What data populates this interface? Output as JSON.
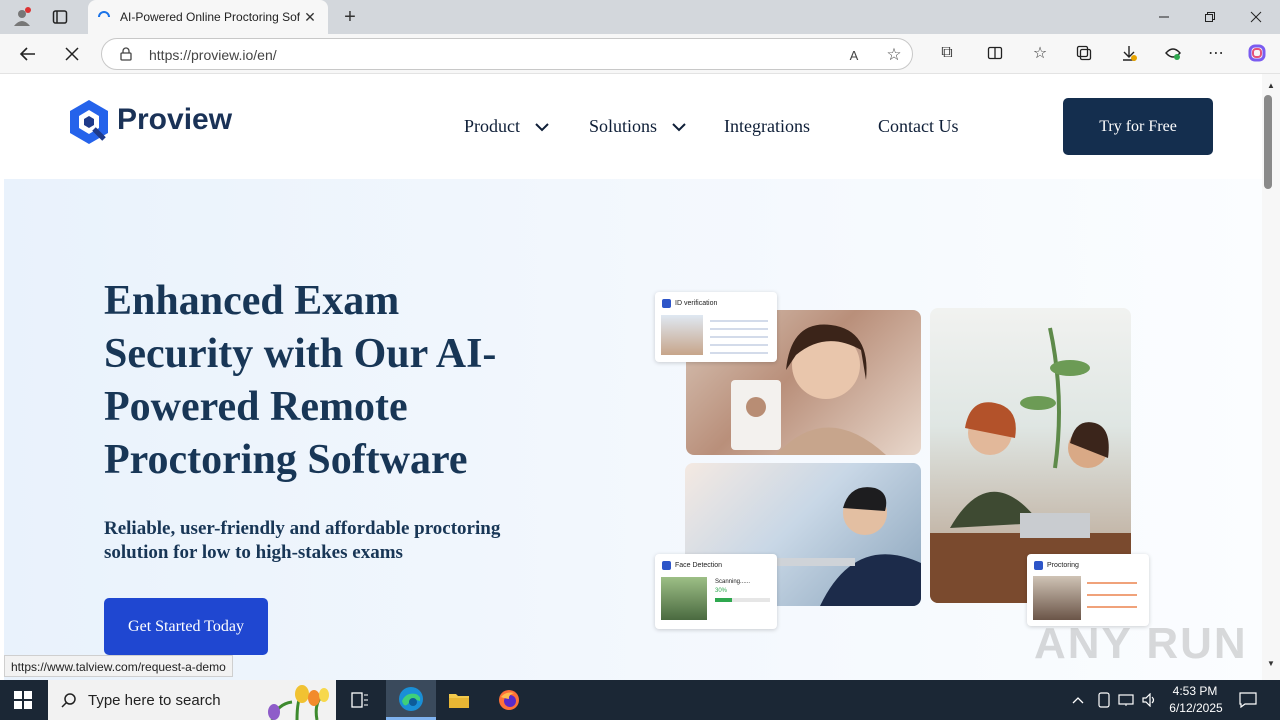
{
  "browser": {
    "tab_title": "AI-Powered Online Proctoring Sof",
    "url": "https://proview.io/en/"
  },
  "site": {
    "logo_text": "Proview",
    "nav": [
      {
        "label": "Product"
      },
      {
        "label": "Solutions"
      },
      {
        "label": "Integrations"
      },
      {
        "label": "Contact Us"
      }
    ],
    "cta_label": "Try for Free"
  },
  "hero": {
    "headline": "Enhanced Exam Security with Our AI-Powered Remote Proctoring Software",
    "subheadline": "Reliable, user-friendly and affordable proctoring solution for low to high-stakes exams",
    "button_label": "Get Started Today",
    "cards": {
      "id_verification": "ID verification",
      "face_detection": "Face Detection",
      "scanning": "Scanning......",
      "percent": "30%",
      "proctoring": "Proctoring"
    }
  },
  "status_url": "https://www.talview.com/request-a-demo",
  "taskbar": {
    "search_placeholder": "Type here to search",
    "time": "4:53 PM",
    "date": "6/12/2025"
  },
  "watermark": "ANY RUN",
  "colors": {
    "brand_dark": "#142e4e",
    "brand_blue": "#1f47d1",
    "headline": "#183656"
  }
}
